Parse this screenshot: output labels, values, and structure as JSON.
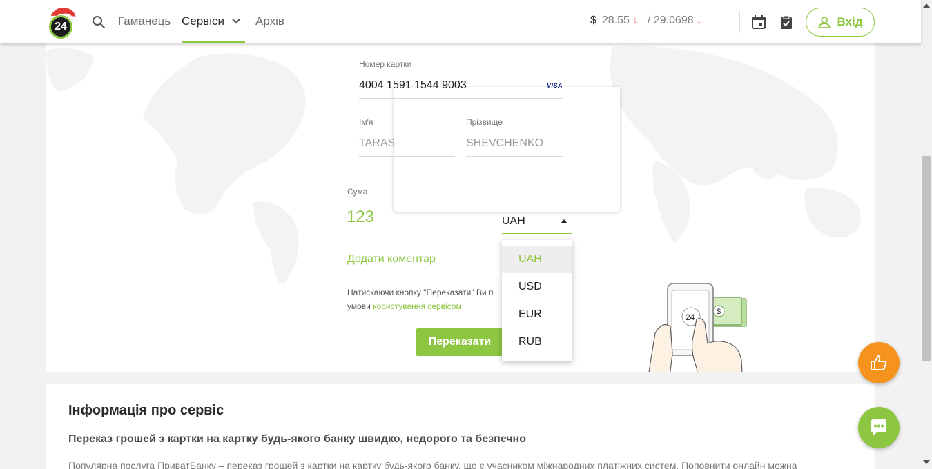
{
  "colors": {
    "accent": "#8dc641",
    "rate_down": "#f08080",
    "fab_like": "#f6921e",
    "fab_chat": "#8dc641"
  },
  "header": {
    "logo_text": "24",
    "nav": [
      {
        "label": "Гаманець"
      },
      {
        "label": "Сервіси"
      },
      {
        "label": "Архів"
      }
    ],
    "rates": {
      "currency_symbol": "$",
      "buy": "28.55",
      "sell": "/ 29.0698",
      "trend_icon": "arrow-down"
    },
    "login_label": "Вхід"
  },
  "card": {
    "number_label": "Номер картки",
    "number_value": "4004 1591 1544 9003",
    "brand": "VISA",
    "first_name_label": "Ім'я",
    "first_name_value": "TARAS",
    "last_name_label": "Прізвище",
    "last_name_value": "SHEVCHENKO"
  },
  "amount": {
    "label": "Сума",
    "value": "123",
    "currency": "UAH"
  },
  "currency_options": [
    "UAH",
    "USD",
    "EUR",
    "RUB"
  ],
  "comment_link": "Додати коментар",
  "terms": {
    "line1": "Натискаючи кнопку \"Переказати\" Ви п",
    "line2_prefix": "умови ",
    "line2_link": "користування сервісом"
  },
  "transfer_button": "Переказати",
  "illustration": {
    "phone_text": "24",
    "bill_text": "$"
  },
  "info": {
    "title": "Інформація про сервіс",
    "subtitle": "Переказ грошей з картки на картку будь-якого банку швидко, недорого та безпечно",
    "text": "Популярна послуга ПриватБанку – переказ грошей з картки на картку будь-якого банку, що є учасником міжнародних платіжних систем. Поповнити онлайн можна"
  }
}
